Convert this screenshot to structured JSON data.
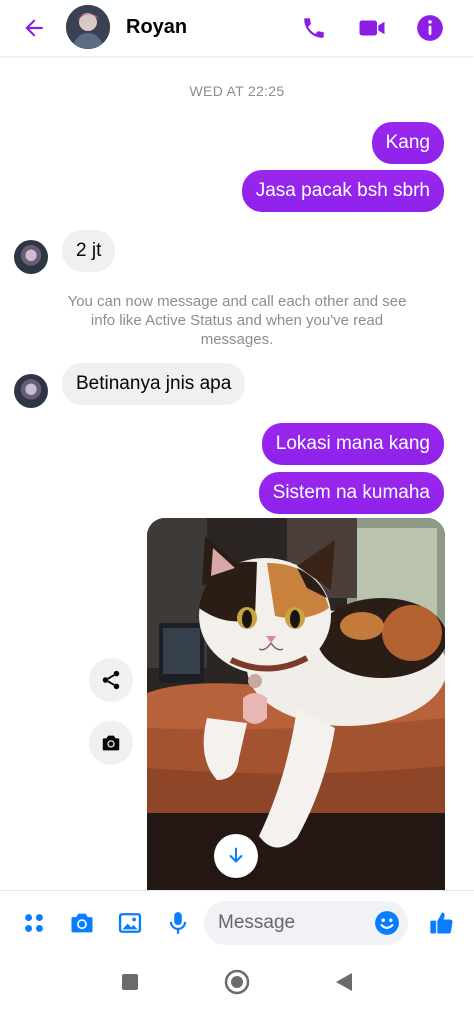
{
  "header": {
    "contact_name": "Royan",
    "icons": {
      "back": "arrow-left-icon",
      "call": "phone-icon",
      "video": "video-camera-icon",
      "info": "info-icon"
    }
  },
  "conversation": {
    "timestamp": "WED AT 22:25",
    "messages": [
      {
        "direction": "outgoing",
        "text": "Kang"
      },
      {
        "direction": "outgoing",
        "text": "Jasa pacak bsh sbrh"
      },
      {
        "direction": "incoming",
        "text": "2 jt"
      },
      {
        "direction": "incoming",
        "text": "Betinanya jnis apa"
      },
      {
        "direction": "outgoing",
        "text": "Lokasi mana kang"
      },
      {
        "direction": "outgoing",
        "text": "Sistem na kumaha"
      }
    ],
    "system_note": "You can now message and call each other and see info like Active Status and when you've read messages.",
    "photo": {
      "subject": "calico cat sitting on a brown leather couch",
      "actions": [
        "share-icon",
        "camera-icon",
        "download-arrow-icon"
      ]
    }
  },
  "composer": {
    "placeholder": "Message",
    "icons": [
      "apps-grid-icon",
      "camera-icon",
      "image-icon",
      "microphone-icon",
      "emoji-icon",
      "thumbs-up-icon"
    ]
  },
  "colors": {
    "accent": "#8c1ee6",
    "outgoing_bubble": "#9327ec",
    "incoming_bubble": "#f0f0f0",
    "composer_icons": "#0a7cff"
  },
  "navbar": {
    "icons": [
      "recents-square-icon",
      "home-circle-icon",
      "back-triangle-icon"
    ]
  }
}
